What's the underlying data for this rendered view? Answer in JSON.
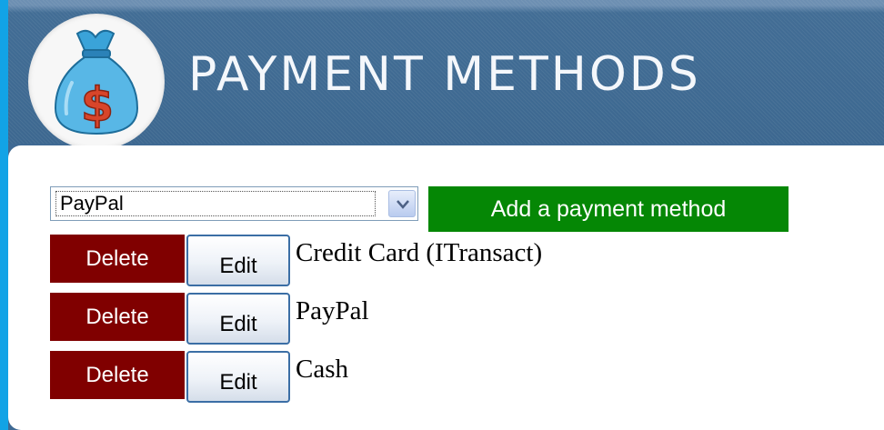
{
  "header": {
    "title": "PAYMENT METHODS",
    "logo_icon": "money-bag-icon",
    "logo_symbol": "$"
  },
  "form": {
    "selected_method": "PayPal",
    "add_button_label": "Add a payment method"
  },
  "methods": [
    {
      "name": "Credit Card (ITransact)",
      "delete_label": "Delete",
      "edit_label": "Edit"
    },
    {
      "name": "PayPal",
      "delete_label": "Delete",
      "edit_label": "Edit"
    },
    {
      "name": "Cash",
      "delete_label": "Delete",
      "edit_label": "Edit"
    }
  ],
  "colors": {
    "page_border": "#12a3e6",
    "header_bg": "#3d6890",
    "add_button": "#058705",
    "delete_button": "#800000",
    "edit_border": "#3b6ea5"
  }
}
